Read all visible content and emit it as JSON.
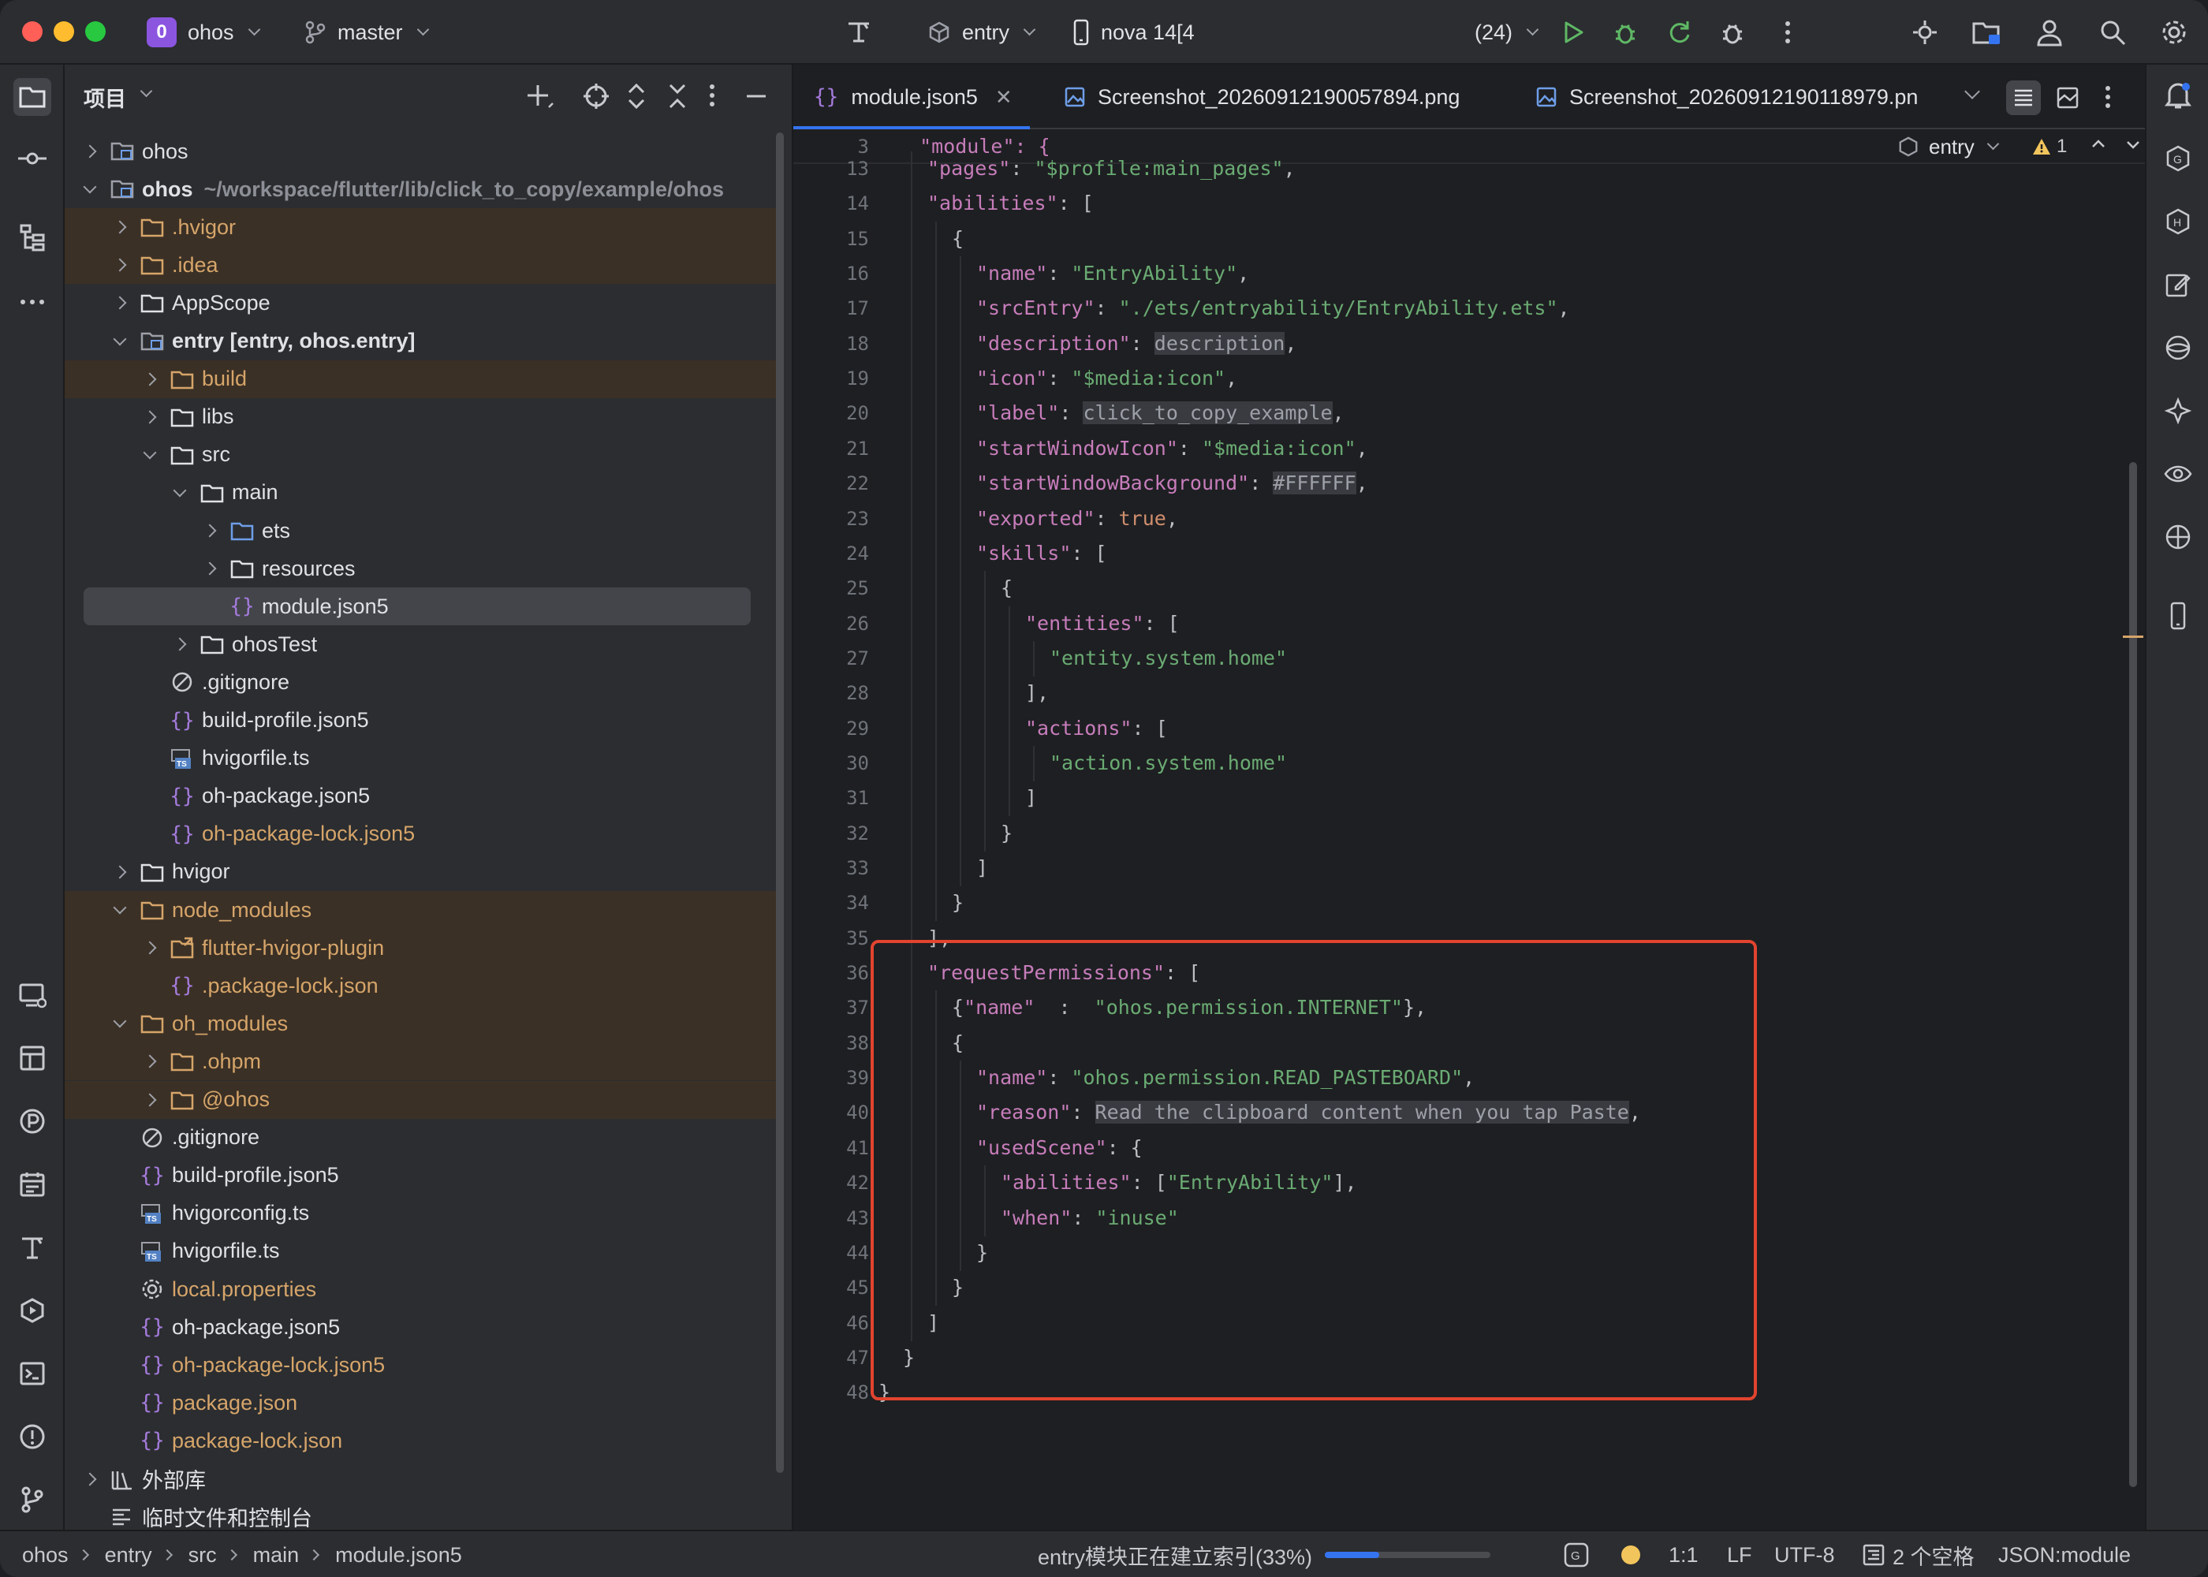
{
  "titlebar": {
    "project_badge": "0",
    "project_name": "ohos",
    "branch": "master",
    "run_config": "entry",
    "device": "nova 14[4",
    "device_suffix": "(24)"
  },
  "project_panel": {
    "title": "项目",
    "tree": [
      {
        "label": "ohos",
        "depth": 0,
        "state": "closed",
        "icon": "module-icon",
        "color": "#dfe1e5"
      },
      {
        "label": "ohos",
        "extra": "~/workspace/flutter/lib/click_to_copy/example/ohos",
        "depth": 0,
        "state": "open",
        "icon": "module-icon",
        "color": "#dfe1e5",
        "bold": true
      },
      {
        "label": ".hvigor",
        "depth": 1,
        "state": "closed",
        "icon": "folder-icon",
        "color": "#d6a56a",
        "excluded": true
      },
      {
        "label": ".idea",
        "depth": 1,
        "state": "closed",
        "icon": "folder-icon",
        "color": "#d6a56a",
        "excluded": true
      },
      {
        "label": "AppScope",
        "depth": 1,
        "state": "closed",
        "icon": "folder-icon",
        "color": "#dfe1e5"
      },
      {
        "label": "entry [entry, ohos.entry]",
        "depth": 1,
        "state": "open",
        "icon": "module-icon",
        "color": "#dfe1e5",
        "bold": true
      },
      {
        "label": "build",
        "depth": 2,
        "state": "closed",
        "icon": "folder-icon",
        "color": "#d6a56a",
        "excluded": true
      },
      {
        "label": "libs",
        "depth": 2,
        "state": "closed",
        "icon": "folder-icon",
        "color": "#dfe1e5"
      },
      {
        "label": "src",
        "depth": 2,
        "state": "open",
        "icon": "folder-icon",
        "color": "#dfe1e5"
      },
      {
        "label": "main",
        "depth": 3,
        "state": "open",
        "icon": "folder-icon",
        "color": "#dfe1e5"
      },
      {
        "label": "ets",
        "depth": 4,
        "state": "closed",
        "icon": "source-folder-icon",
        "color": "#dfe1e5"
      },
      {
        "label": "resources",
        "depth": 4,
        "state": "closed",
        "icon": "folder-icon",
        "color": "#dfe1e5"
      },
      {
        "label": "module.json5",
        "depth": 4,
        "state": "leaf",
        "icon": "json-icon",
        "color": "#dfe1e5",
        "selected": true
      },
      {
        "label": "ohosTest",
        "depth": 3,
        "state": "closed",
        "icon": "folder-icon",
        "color": "#dfe1e5"
      },
      {
        "label": ".gitignore",
        "depth": 2,
        "state": "leaf",
        "icon": "ignore-icon",
        "color": "#dfe1e5"
      },
      {
        "label": "build-profile.json5",
        "depth": 2,
        "state": "leaf",
        "icon": "json-icon",
        "color": "#dfe1e5"
      },
      {
        "label": "hvigorfile.ts",
        "depth": 2,
        "state": "leaf",
        "icon": "ts-icon",
        "color": "#dfe1e5"
      },
      {
        "label": "oh-package.json5",
        "depth": 2,
        "state": "leaf",
        "icon": "json-icon",
        "color": "#dfe1e5"
      },
      {
        "label": "oh-package-lock.json5",
        "depth": 2,
        "state": "leaf",
        "icon": "json-icon",
        "color": "#d6a56a"
      },
      {
        "label": "hvigor",
        "depth": 1,
        "state": "closed",
        "icon": "folder-icon",
        "color": "#dfe1e5"
      },
      {
        "label": "node_modules",
        "depth": 1,
        "state": "open",
        "icon": "folder-icon",
        "color": "#d6a56a",
        "excluded": true
      },
      {
        "label": "flutter-hvigor-plugin",
        "depth": 2,
        "state": "closed",
        "icon": "symlink-folder-icon",
        "color": "#d6a56a",
        "excluded": true
      },
      {
        "label": ".package-lock.json",
        "depth": 2,
        "state": "leaf",
        "icon": "json-icon",
        "color": "#d6a56a",
        "excluded": true
      },
      {
        "label": "oh_modules",
        "depth": 1,
        "state": "open",
        "icon": "folder-icon",
        "color": "#d6a56a",
        "excluded": true
      },
      {
        "label": ".ohpm",
        "depth": 2,
        "state": "closed",
        "icon": "folder-icon",
        "color": "#d6a56a",
        "excluded": true
      },
      {
        "label": "@ohos",
        "depth": 2,
        "state": "closed",
        "icon": "folder-icon",
        "color": "#d6a56a",
        "excluded": true
      },
      {
        "label": ".gitignore",
        "depth": 1,
        "state": "leaf",
        "icon": "ignore-icon",
        "color": "#dfe1e5"
      },
      {
        "label": "build-profile.json5",
        "depth": 1,
        "state": "leaf",
        "icon": "json-icon",
        "color": "#dfe1e5"
      },
      {
        "label": "hvigorconfig.ts",
        "depth": 1,
        "state": "leaf",
        "icon": "ts-icon",
        "color": "#dfe1e5"
      },
      {
        "label": "hvigorfile.ts",
        "depth": 1,
        "state": "leaf",
        "icon": "ts-icon",
        "color": "#dfe1e5"
      },
      {
        "label": "local.properties",
        "depth": 1,
        "state": "leaf",
        "icon": "settings-file-icon",
        "color": "#d6a56a"
      },
      {
        "label": "oh-package.json5",
        "depth": 1,
        "state": "leaf",
        "icon": "json-icon",
        "color": "#dfe1e5"
      },
      {
        "label": "oh-package-lock.json5",
        "depth": 1,
        "state": "leaf",
        "icon": "json-icon",
        "color": "#d6a56a"
      },
      {
        "label": "package.json",
        "depth": 1,
        "state": "leaf",
        "icon": "json-icon",
        "color": "#d6a56a"
      },
      {
        "label": "package-lock.json",
        "depth": 1,
        "state": "leaf",
        "icon": "json-icon",
        "color": "#d6a56a"
      },
      {
        "label": "外部库",
        "depth": 0,
        "state": "closed",
        "icon": "library-icon",
        "color": "#dfe1e5"
      },
      {
        "label": "临时文件和控制台",
        "depth": 0,
        "state": "leaf",
        "icon": "scratch-icon",
        "color": "#dfe1e5"
      }
    ]
  },
  "editor": {
    "tabs": [
      {
        "label": "module.json5",
        "active": true,
        "icon": "json-icon"
      },
      {
        "label": "Screenshot_20260912190057894.png",
        "active": false,
        "icon": "image-icon"
      },
      {
        "label": "Screenshot_20260912190118979.pn",
        "active": false,
        "icon": "image-icon"
      }
    ],
    "scope": "entry",
    "warnings": "1",
    "sticky_line": {
      "num": "3",
      "text": "  \"module\": {"
    },
    "lines": [
      {
        "num": "13",
        "indent": 2,
        "tokens": [
          [
            "k",
            "\"pages\""
          ],
          [
            "p",
            ": "
          ],
          [
            "s",
            "\"$profile:main_pages\""
          ],
          [
            "p",
            ","
          ]
        ]
      },
      {
        "num": "14",
        "indent": 2,
        "tokens": [
          [
            "k",
            "\"abilities\""
          ],
          [
            "p",
            ": ["
          ]
        ]
      },
      {
        "num": "15",
        "indent": 3,
        "tokens": [
          [
            "p",
            "{"
          ]
        ]
      },
      {
        "num": "16",
        "indent": 4,
        "tokens": [
          [
            "k",
            "\"name\""
          ],
          [
            "p",
            ": "
          ],
          [
            "s",
            "\"EntryAbility\""
          ],
          [
            "p",
            ","
          ]
        ]
      },
      {
        "num": "17",
        "indent": 4,
        "tokens": [
          [
            "k",
            "\"srcEntry\""
          ],
          [
            "p",
            ": "
          ],
          [
            "s",
            "\"./ets/entryability/EntryAbility.ets\""
          ],
          [
            "p",
            ","
          ]
        ]
      },
      {
        "num": "18",
        "indent": 4,
        "tokens": [
          [
            "k",
            "\"description\""
          ],
          [
            "p",
            ": "
          ],
          [
            "hl",
            "description"
          ],
          [
            "p",
            ","
          ]
        ]
      },
      {
        "num": "19",
        "indent": 4,
        "tokens": [
          [
            "k",
            "\"icon\""
          ],
          [
            "p",
            ": "
          ],
          [
            "s",
            "\"$media:icon\""
          ],
          [
            "p",
            ","
          ]
        ]
      },
      {
        "num": "20",
        "indent": 4,
        "tokens": [
          [
            "k",
            "\"label\""
          ],
          [
            "p",
            ": "
          ],
          [
            "hl",
            "click_to_copy_example"
          ],
          [
            "p",
            ","
          ]
        ]
      },
      {
        "num": "21",
        "indent": 4,
        "tokens": [
          [
            "k",
            "\"startWindowIcon\""
          ],
          [
            "p",
            ": "
          ],
          [
            "s",
            "\"$media:icon\""
          ],
          [
            "p",
            ","
          ]
        ]
      },
      {
        "num": "22",
        "indent": 4,
        "tokens": [
          [
            "k",
            "\"startWindowBackground\""
          ],
          [
            "p",
            ": "
          ],
          [
            "hl",
            "#FFFFFF"
          ],
          [
            "p",
            ","
          ]
        ]
      },
      {
        "num": "23",
        "indent": 4,
        "tokens": [
          [
            "k",
            "\"exported\""
          ],
          [
            "p",
            ": "
          ],
          [
            "b",
            "true"
          ],
          [
            "p",
            ","
          ]
        ]
      },
      {
        "num": "24",
        "indent": 4,
        "tokens": [
          [
            "k",
            "\"skills\""
          ],
          [
            "p",
            ": ["
          ]
        ]
      },
      {
        "num": "25",
        "indent": 5,
        "tokens": [
          [
            "p",
            "{"
          ]
        ]
      },
      {
        "num": "26",
        "indent": 6,
        "tokens": [
          [
            "k",
            "\"entities\""
          ],
          [
            "p",
            ": ["
          ]
        ]
      },
      {
        "num": "27",
        "indent": 7,
        "tokens": [
          [
            "s",
            "\"entity.system.home\""
          ]
        ]
      },
      {
        "num": "28",
        "indent": 6,
        "tokens": [
          [
            "p",
            "],"
          ]
        ]
      },
      {
        "num": "29",
        "indent": 6,
        "tokens": [
          [
            "k",
            "\"actions\""
          ],
          [
            "p",
            ": ["
          ]
        ]
      },
      {
        "num": "30",
        "indent": 7,
        "tokens": [
          [
            "s",
            "\"action.system.home\""
          ]
        ]
      },
      {
        "num": "31",
        "indent": 6,
        "tokens": [
          [
            "p",
            "]"
          ]
        ]
      },
      {
        "num": "32",
        "indent": 5,
        "tokens": [
          [
            "p",
            "}"
          ]
        ]
      },
      {
        "num": "33",
        "indent": 4,
        "tokens": [
          [
            "p",
            "]"
          ]
        ]
      },
      {
        "num": "34",
        "indent": 3,
        "tokens": [
          [
            "p",
            "}"
          ]
        ]
      },
      {
        "num": "35",
        "indent": 2,
        "tokens": [
          [
            "p",
            "],"
          ]
        ]
      },
      {
        "num": "36",
        "indent": 2,
        "tokens": [
          [
            "k",
            "\"requestPermissions\""
          ],
          [
            "p",
            ": ["
          ]
        ]
      },
      {
        "num": "37",
        "indent": 3,
        "tokens": [
          [
            "p",
            "{"
          ],
          [
            "k",
            "\"name\""
          ],
          [
            "p",
            "  :  "
          ],
          [
            "s",
            "\"ohos.permission.INTERNET\""
          ],
          [
            "p",
            "},"
          ]
        ]
      },
      {
        "num": "38",
        "indent": 3,
        "tokens": [
          [
            "p",
            "{"
          ]
        ]
      },
      {
        "num": "39",
        "indent": 4,
        "tokens": [
          [
            "k",
            "\"name\""
          ],
          [
            "p",
            ": "
          ],
          [
            "s",
            "\"ohos.permission.READ_PASTEBOARD\""
          ],
          [
            "p",
            ","
          ]
        ]
      },
      {
        "num": "40",
        "indent": 4,
        "tokens": [
          [
            "k",
            "\"reason\""
          ],
          [
            "p",
            ": "
          ],
          [
            "hl",
            "Read the clipboard content when you tap Paste"
          ],
          [
            "p",
            ","
          ]
        ]
      },
      {
        "num": "41",
        "indent": 4,
        "tokens": [
          [
            "k",
            "\"usedScene\""
          ],
          [
            "p",
            ": {"
          ]
        ]
      },
      {
        "num": "42",
        "indent": 5,
        "tokens": [
          [
            "k",
            "\"abilities\""
          ],
          [
            "p",
            ": ["
          ],
          [
            "s",
            "\"EntryAbility\""
          ],
          [
            "p",
            "],"
          ]
        ]
      },
      {
        "num": "43",
        "indent": 5,
        "tokens": [
          [
            "k",
            "\"when\""
          ],
          [
            "p",
            ": "
          ],
          [
            "s",
            "\"inuse\""
          ]
        ]
      },
      {
        "num": "44",
        "indent": 4,
        "tokens": [
          [
            "p",
            "}"
          ]
        ]
      },
      {
        "num": "45",
        "indent": 3,
        "tokens": [
          [
            "p",
            "}"
          ]
        ]
      },
      {
        "num": "46",
        "indent": 2,
        "tokens": [
          [
            "p",
            "]"
          ]
        ]
      },
      {
        "num": "47",
        "indent": 1,
        "tokens": [
          [
            "p",
            "}"
          ]
        ]
      },
      {
        "num": "48",
        "indent": 0,
        "tokens": [
          [
            "p",
            "}"
          ]
        ]
      }
    ]
  },
  "statusbar": {
    "breadcrumb": [
      "ohos",
      "entry",
      "src",
      "main",
      "module.json5"
    ],
    "indexing": "entry模块正在建立索引(33%)",
    "indexing_progress": 0.33,
    "position": "1:1",
    "line_sep": "LF",
    "encoding": "UTF-8",
    "indent": "2 个空格",
    "schema": "JSON:module"
  },
  "colors": {
    "highlight_box": "#e2442f",
    "accent": "#3574f0"
  }
}
